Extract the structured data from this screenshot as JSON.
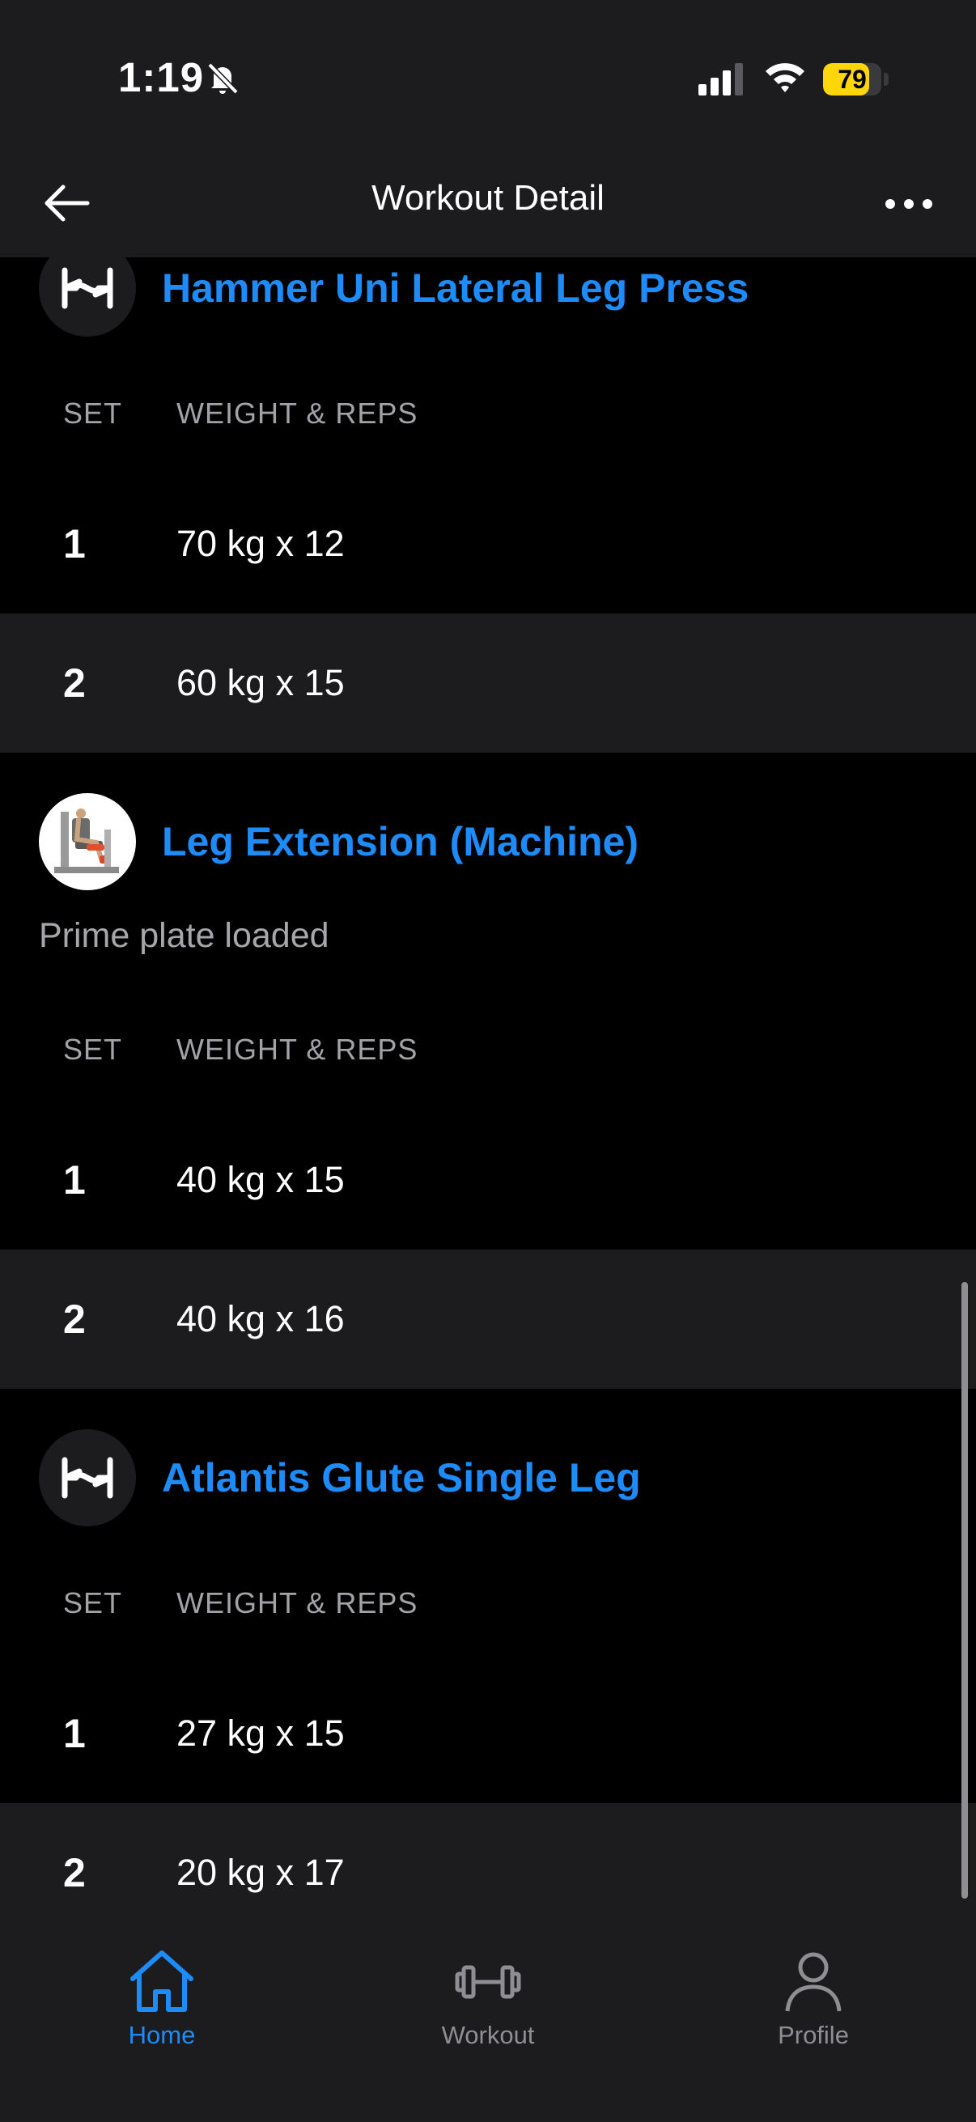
{
  "status_bar": {
    "time": "1:19",
    "battery": "79",
    "battery_level": 0.79
  },
  "header": {
    "title": "Workout Detail"
  },
  "columns": {
    "set": "SET",
    "weight_reps": "WEIGHT & REPS"
  },
  "exercises": [
    {
      "name": "Hammer Uni Lateral Leg Press",
      "icon": "hevy-logo-icon",
      "sets": [
        {
          "set": "1",
          "value": "70 kg x 12"
        },
        {
          "set": "2",
          "value": "60 kg x 15"
        }
      ]
    },
    {
      "name": "Leg Extension (Machine)",
      "icon": "leg-extension-machine-image",
      "note": "Prime plate loaded",
      "sets": [
        {
          "set": "1",
          "value": "40 kg x 15"
        },
        {
          "set": "2",
          "value": "40 kg x 16"
        }
      ]
    },
    {
      "name": "Atlantis Glute Single Leg",
      "icon": "hevy-logo-icon",
      "sets": [
        {
          "set": "1",
          "value": "27 kg x 15"
        },
        {
          "set": "2",
          "value": "20 kg x 17"
        }
      ]
    }
  ],
  "tabbar": {
    "items": [
      {
        "label": "Home",
        "icon": "home-icon",
        "active": true
      },
      {
        "label": "Workout",
        "icon": "dumbbell-icon",
        "active": false
      },
      {
        "label": "Profile",
        "icon": "person-icon",
        "active": false
      }
    ]
  },
  "colors": {
    "accent": "#1d8cf8",
    "background": "#000000",
    "surface": "#1c1c1e",
    "battery": "#ffd60a"
  }
}
